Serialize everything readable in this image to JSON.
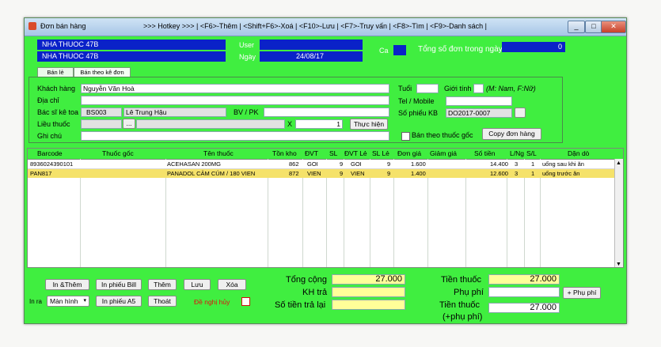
{
  "window": {
    "title": "Đơn bán hàng",
    "hotkeys": ">>> Hotkey >>>   |   <F6>-Thêm   |   <Shift+F6>-Xoá   |   <F10>-Lưu   |   <F7>-Truy vấn   |   <F8>-Tìm   |   <F9>-Danh sách   |",
    "min": "_",
    "max": "□",
    "close": "✕"
  },
  "header": {
    "store1": "NHA THUOC 47B",
    "store2": "NHA THUOC 47B",
    "user_label": "User",
    "date_label": "Ngày",
    "date_value": "24/08/17",
    "ca_label": "Ca",
    "order_count_label": "Tổng số đơn trong ngày",
    "order_count_value": "0"
  },
  "tabs": [
    "Bán lẻ",
    "Bán theo kê đơn"
  ],
  "form": {
    "customer_label": "Khách hàng",
    "customer_value": "Nguyễn Văn Hoà",
    "address_label": "Địa chỉ",
    "doctor_label": "Bác sĩ kê toa",
    "doctor_code": "BS003",
    "doctor_name": "Lê Trung Hậu",
    "hospital_label": "BV / PK",
    "dose_label": "Liều thuốc",
    "dose_button": "...",
    "times_label": "X",
    "dose_count": "1",
    "execute_button": "Thực hiện",
    "note_label": "Ghi chú",
    "age_label": "Tuổi",
    "gender_label": "Giới tính",
    "gender_hint": "(M: Nam, F:Nữ)",
    "phone_label": "Tel / Mobile",
    "receipt_label": "Số phiếu KB",
    "receipt_value": "DO2017-0007",
    "sell_by_generic_label": "Bán theo thuốc gốc",
    "copy_order_button": "Copy đơn hàng"
  },
  "grid": {
    "columns": [
      "Barcode",
      "Thuốc gốc",
      "Tên thuốc",
      "Tồn kho",
      "ĐVT",
      "SL",
      "ĐVT Lẻ",
      "SL Lẻ",
      "Đơn giá",
      "Giảm giá",
      "Số tiền",
      "L/Ng",
      "S/L",
      "Dặn dò"
    ],
    "rows": [
      {
        "barcode": "8936024390101",
        "generic": "",
        "name": "ACEHASAN 200MG",
        "stock": "862",
        "unit": "GOI",
        "qty": "9",
        "unit_small": "GOI",
        "qty_small": "9",
        "price": "1.600",
        "discount": "",
        "amount": "14.400",
        "per_day": "3",
        "times": "1",
        "note": "uống sau khi ăn"
      },
      {
        "barcode": "PAN817",
        "generic": "",
        "name": "PANADOL CẢM CÚM / 180 VIEN",
        "stock": "872",
        "unit": "VIEN",
        "qty": "9",
        "unit_small": "VIEN",
        "qty_small": "9",
        "price": "1.400",
        "discount": "",
        "amount": "12.600",
        "per_day": "3",
        "times": "1",
        "note": "uống trước ăn"
      }
    ]
  },
  "actions": {
    "print_add": "In &Thêm",
    "print_bill": "In phiếu Bill",
    "add": "Thêm",
    "save": "Lưu",
    "delete": "Xóa",
    "print_out_label": "In ra",
    "print_target": "Màn hình",
    "print_a5": "In phiếu A5",
    "exit": "Thoát",
    "cancel_request": "Đề nghị hủy"
  },
  "totals": {
    "total_label": "Tổng cộng",
    "total_value": "27.000",
    "paid_label": "KH trả",
    "paid_value": "",
    "change_label": "Số tiền trả lại",
    "change_value": "",
    "medicine_label": "Tiền thuốc",
    "medicine_value": "27.000",
    "fee_label": "Phụ phí",
    "fee_value": "",
    "fee_button": "+ Phụ phí",
    "medicine_fee_label_1": "Tiền thuốc",
    "medicine_fee_label_2": "(+phụ phí)",
    "medicine_fee_value": "27.000"
  },
  "colors": {
    "window_bg": "#40ee40",
    "header_bg": "#0a22c8",
    "input_yellow": "#ffff99",
    "selected_row": "#f5e26a"
  }
}
